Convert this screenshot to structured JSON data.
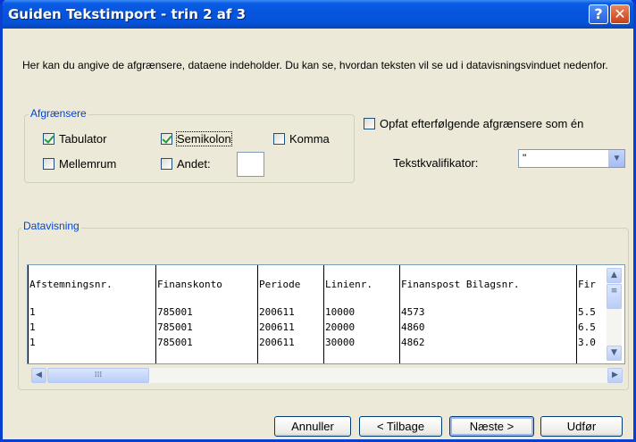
{
  "window": {
    "title": "Guiden Tekstimport - trin 2 af 3",
    "help_label": "?",
    "close_label": "✕"
  },
  "intro_text": "Her kan du angive de afgrænsere, dataene indeholder. Du kan se, hvordan teksten vil se ud i datavisningsvinduet nedenfor.",
  "delimiters": {
    "group_label": "Afgrænsere",
    "tabulator": {
      "label": "Tabulator",
      "checked": true
    },
    "semikolon": {
      "label": "Semikolon",
      "checked": true
    },
    "komma": {
      "label": "Komma",
      "checked": false
    },
    "mellemrum": {
      "label": "Mellemrum",
      "checked": false
    },
    "andet": {
      "label": "Andet:",
      "checked": false,
      "value": ""
    }
  },
  "consecutive": {
    "label": "Opfat efterfølgende afgrænsere som én",
    "checked": false
  },
  "qualifier": {
    "label": "Tekstkvalifikator:",
    "value": "\""
  },
  "preview": {
    "group_label": "Datavisning",
    "columns": [
      {
        "header": "Afstemningsnr.",
        "rows": [
          "",
          "1",
          "1",
          "1"
        ]
      },
      {
        "header": "Finanskonto",
        "rows": [
          "",
          "785001",
          "785001",
          "785001"
        ]
      },
      {
        "header": "Periode",
        "rows": [
          "",
          "200611",
          "200611",
          "200611"
        ]
      },
      {
        "header": "Linienr.",
        "rows": [
          "",
          "10000",
          "20000",
          "30000"
        ]
      },
      {
        "header": "Finanspost Bilagsnr.",
        "rows": [
          "",
          "4573",
          "4860",
          "4862"
        ]
      },
      {
        "header": "Fir",
        "rows": [
          "",
          "5.5",
          "6.5",
          "3.0"
        ]
      }
    ]
  },
  "buttons": {
    "cancel": "Annuller",
    "back": "< Tilbage",
    "next": "Næste >",
    "finish": "Udfør"
  }
}
